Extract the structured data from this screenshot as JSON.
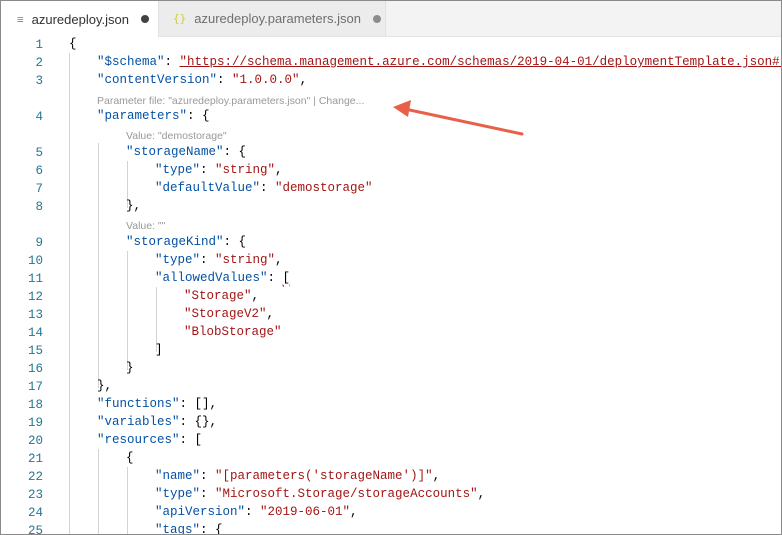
{
  "tabs": [
    {
      "label": "azuredeploy.json",
      "icon": "lines-icon",
      "icon_glyph": "≡",
      "active": true
    },
    {
      "label": "azuredeploy.parameters.json",
      "icon": "braces-icon",
      "icon_glyph": "{}",
      "active": false
    }
  ],
  "lines": [
    {
      "n": "1",
      "tokens": [
        {
          "t": "{",
          "c": "p"
        }
      ]
    },
    {
      "n": "2",
      "tokens": [
        {
          "t": "\"$schema\"",
          "c": "k"
        },
        {
          "t": ": ",
          "c": "p"
        },
        {
          "t": "\"https://schema.management.azure.com/schemas/2019-04-01/deploymentTemplate.json#\"",
          "c": "s u"
        },
        {
          "t": ",",
          "c": "p"
        }
      ]
    },
    {
      "n": "3",
      "tokens": [
        {
          "t": "\"contentVersion\"",
          "c": "k"
        },
        {
          "t": ": ",
          "c": "p"
        },
        {
          "t": "\"1.0.0.0\"",
          "c": "s"
        },
        {
          "t": ",",
          "c": "p"
        }
      ]
    },
    {
      "n": "4",
      "tokens": [
        {
          "t": "\"parameters\"",
          "c": "k"
        },
        {
          "t": ": {",
          "c": "p"
        }
      ]
    },
    {
      "n": "5",
      "tokens": [
        {
          "t": "\"storageName\"",
          "c": "k"
        },
        {
          "t": ": {",
          "c": "p"
        }
      ]
    },
    {
      "n": "6",
      "tokens": [
        {
          "t": "\"type\"",
          "c": "k"
        },
        {
          "t": ": ",
          "c": "p"
        },
        {
          "t": "\"string\"",
          "c": "s"
        },
        {
          "t": ",",
          "c": "p"
        }
      ]
    },
    {
      "n": "7",
      "tokens": [
        {
          "t": "\"defaultValue\"",
          "c": "k"
        },
        {
          "t": ": ",
          "c": "p"
        },
        {
          "t": "\"demostorage\"",
          "c": "s"
        }
      ]
    },
    {
      "n": "8",
      "tokens": [
        {
          "t": "},",
          "c": "p"
        }
      ]
    },
    {
      "n": "9",
      "tokens": [
        {
          "t": "\"storageKind\"",
          "c": "k"
        },
        {
          "t": ": {",
          "c": "p"
        }
      ]
    },
    {
      "n": "10",
      "tokens": [
        {
          "t": "\"type\"",
          "c": "k"
        },
        {
          "t": ": ",
          "c": "p"
        },
        {
          "t": "\"string\"",
          "c": "s"
        },
        {
          "t": ",",
          "c": "p"
        }
      ]
    },
    {
      "n": "11",
      "tokens": [
        {
          "t": "\"allowedValues\"",
          "c": "k"
        },
        {
          "t": ": ",
          "c": "p"
        },
        {
          "t": "[",
          "c": "p squig"
        }
      ]
    },
    {
      "n": "12",
      "tokens": [
        {
          "t": "\"Storage\"",
          "c": "s"
        },
        {
          "t": ",",
          "c": "p"
        }
      ]
    },
    {
      "n": "13",
      "tokens": [
        {
          "t": "\"StorageV2\"",
          "c": "s"
        },
        {
          "t": ",",
          "c": "p"
        }
      ]
    },
    {
      "n": "14",
      "tokens": [
        {
          "t": "\"BlobStorage\"",
          "c": "s"
        }
      ]
    },
    {
      "n": "15",
      "tokens": [
        {
          "t": "]",
          "c": "p"
        }
      ]
    },
    {
      "n": "16",
      "tokens": [
        {
          "t": "}",
          "c": "p"
        }
      ]
    },
    {
      "n": "17",
      "tokens": [
        {
          "t": "},",
          "c": "p"
        }
      ]
    },
    {
      "n": "18",
      "tokens": [
        {
          "t": "\"functions\"",
          "c": "k"
        },
        {
          "t": ": [],",
          "c": "p"
        }
      ]
    },
    {
      "n": "19",
      "tokens": [
        {
          "t": "\"variables\"",
          "c": "k"
        },
        {
          "t": ": {},",
          "c": "p"
        }
      ]
    },
    {
      "n": "20",
      "tokens": [
        {
          "t": "\"resources\"",
          "c": "k"
        },
        {
          "t": ": [",
          "c": "p"
        }
      ]
    },
    {
      "n": "21",
      "tokens": [
        {
          "t": "{",
          "c": "p"
        }
      ]
    },
    {
      "n": "22",
      "tokens": [
        {
          "t": "\"name\"",
          "c": "k"
        },
        {
          "t": ": ",
          "c": "p"
        },
        {
          "t": "\"[parameters('storageName')]\"",
          "c": "s"
        },
        {
          "t": ",",
          "c": "p"
        }
      ]
    },
    {
      "n": "23",
      "tokens": [
        {
          "t": "\"type\"",
          "c": "k"
        },
        {
          "t": ": ",
          "c": "p"
        },
        {
          "t": "\"Microsoft.Storage/storageAccounts\"",
          "c": "s"
        },
        {
          "t": ",",
          "c": "p"
        }
      ]
    },
    {
      "n": "24",
      "tokens": [
        {
          "t": "\"apiVersion\"",
          "c": "k"
        },
        {
          "t": ": ",
          "c": "p"
        },
        {
          "t": "\"2019-06-01\"",
          "c": "s"
        },
        {
          "t": ",",
          "c": "p"
        }
      ]
    },
    {
      "n": "25",
      "tokens": [
        {
          "t": "\"tags\"",
          "c": "k"
        },
        {
          "t": ": {",
          "c": "p"
        }
      ]
    }
  ],
  "lenses": {
    "parameter_file": "Parameter file: \"azuredeploy.parameters.json\" | Change...",
    "value_demostorage": "Value: \"demostorage\"",
    "value_empty": "Value: \"\""
  },
  "colors": {
    "key": "#0451a5",
    "string": "#a31515",
    "line_number": "#237893",
    "arrow": "#e8604a"
  }
}
